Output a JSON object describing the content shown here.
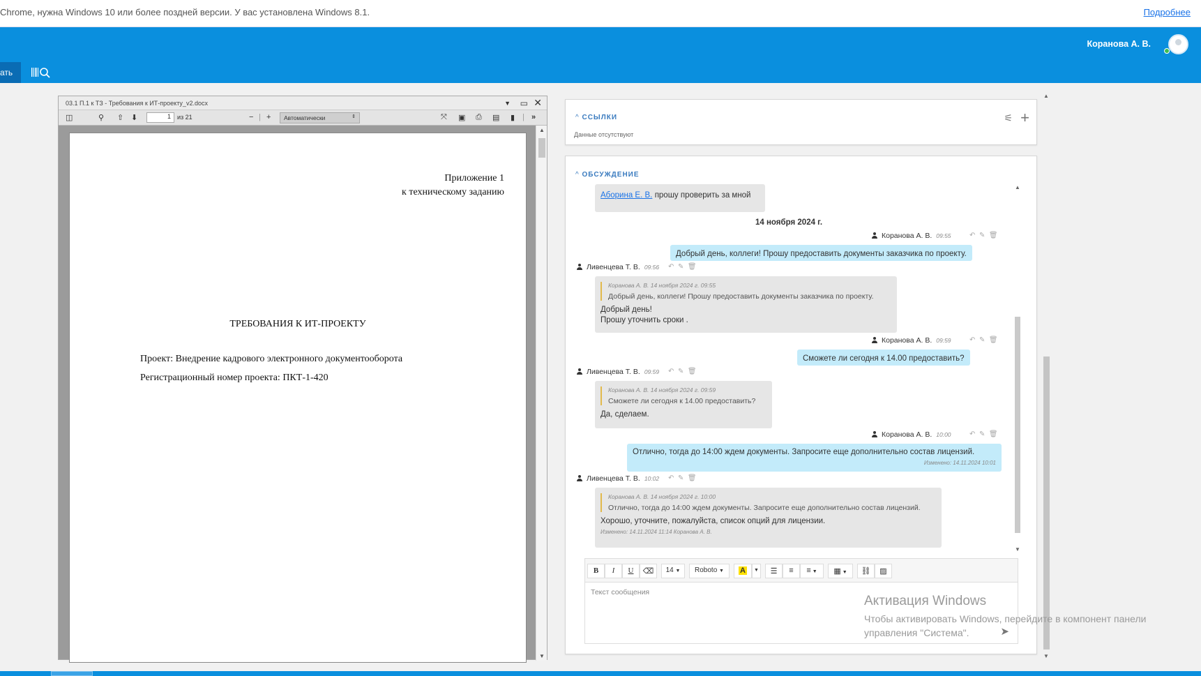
{
  "notice": {
    "message": "Chrome, нужна Windows 10 или более поздней версии. У вас установлена Windows 8.1.",
    "more_link": "Подробнее"
  },
  "header": {
    "user_name": "Коранова А. В."
  },
  "subbar": {
    "tab_label": "ать"
  },
  "viewer": {
    "file_title": "03.1 П.1 к ТЗ - Требования к ИТ-проекту_v2.docx",
    "page_current": "1",
    "page_of": "из 21",
    "zoom": "Автоматически",
    "doc": {
      "appendix_line1": "Приложение 1",
      "appendix_line2": "к техническому заданию",
      "title": "ТРЕБОВАНИЯ К ИТ-ПРОЕКТУ",
      "project": "Проект: Внедрение кадрового электронного документооборота",
      "reg_number": "Регистрационный номер проекта: ПКТ-1-420"
    }
  },
  "links": {
    "title": "ССЫЛКИ",
    "empty": "Данные отсутствуют"
  },
  "discussion": {
    "title": "ОБСУЖДЕНИЕ",
    "first_bubble": {
      "mention": "Аборина Е. В.",
      "text": "прошу проверить за мной"
    },
    "date_separator": "14 ноября 2024 г.",
    "messages": [
      {
        "author": "Коранова А. В.",
        "time": "09:55",
        "text": "Добрый день, коллеги! Прошу предоставить документы заказчика по проекту."
      },
      {
        "author": "Ливенцева Т. В.",
        "time": "09:56",
        "quote_meta": "Коранова А. В. 14 ноября 2024 г. 09:55",
        "quote_text": "Добрый день, коллеги! Прошу предоставить документы заказчика по проекту.",
        "text_line1": "Добрый день!",
        "text_line2": "Прошу уточнить сроки ."
      },
      {
        "author": "Коранова А. В.",
        "time": "09:59",
        "text": "Сможете ли сегодня к 14.00 предоставить?"
      },
      {
        "author": "Ливенцева Т. В.",
        "time": "09:59",
        "quote_meta": "Коранова А. В. 14 ноября 2024 г. 09:59",
        "quote_text": "Сможете ли сегодня к 14.00 предоставить?",
        "text": "Да, сделаем."
      },
      {
        "author": "Коранова А. В.",
        "time": "10:00",
        "text": "Отлично, тогда до 14:00 ждем документы. Запросите еще дополнительно состав лицензий.",
        "edited": "Изменено: 14.11.2024 10:01"
      },
      {
        "author": "Ливенцева Т. В.",
        "time": "10:02",
        "quote_meta": "Коранова А. В. 14 ноября 2024 г. 10:00",
        "quote_text": "Отлично, тогда до 14:00 ждем документы. Запросите еще дополнительно состав лицензий.",
        "text": "Хорошо, уточните, пожалуйста, список опций для лицензии.",
        "edited": "Изменено: 14.11.2024 11:14 Коранова А. В."
      }
    ],
    "editor": {
      "bold": "B",
      "italic": "I",
      "underline": "U",
      "font_size": "14",
      "font_name": "Roboto",
      "placeholder": "Текст сообщения"
    }
  },
  "watermark": {
    "title": "Активация Windows",
    "line1": "Чтобы активировать Windows, перейдите в компонент панели",
    "line2": "управления \"Система\"."
  },
  "colors": {
    "header": "#0a8fde",
    "bubble_out": "#c3ebfa",
    "bubble_in": "#e6e6e6",
    "section_title": "#3a7bbf",
    "quote_bar": "#e2b94b"
  }
}
